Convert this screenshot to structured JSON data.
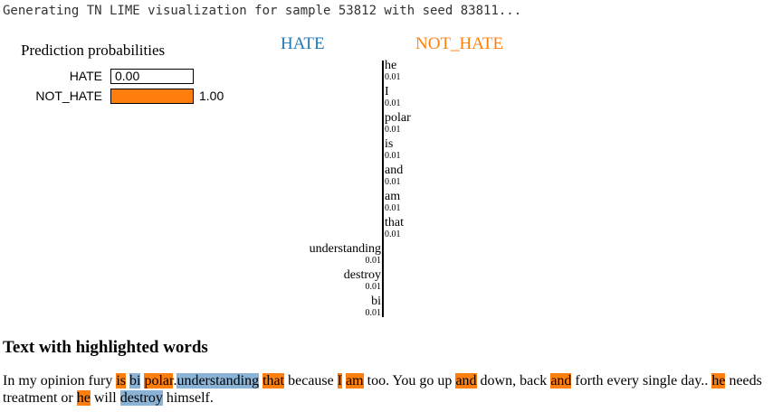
{
  "console": {
    "text": "Generating TN LIME visualization for sample 53812 with seed 83811..."
  },
  "probabilities": {
    "title": "Prediction probabilities",
    "items": [
      {
        "label": "HATE",
        "value": 0.0,
        "value_text": "0.00",
        "color": "#1f77b4"
      },
      {
        "label": "NOT_HATE",
        "value": 1.0,
        "value_text": "1.00",
        "color": "#ff7f0e"
      }
    ]
  },
  "classes": {
    "negative": {
      "label": "HATE",
      "color": "#1f77b4"
    },
    "positive": {
      "label": "NOT_HATE",
      "color": "#ff7f0e"
    }
  },
  "features": {
    "positive": [
      {
        "word": "he",
        "weight": "0.01"
      },
      {
        "word": "I",
        "weight": "0.01"
      },
      {
        "word": "polar",
        "weight": "0.01"
      },
      {
        "word": "is",
        "weight": "0.01"
      },
      {
        "word": "and",
        "weight": "0.01"
      },
      {
        "word": "am",
        "weight": "0.01"
      },
      {
        "word": "that",
        "weight": "0.01"
      }
    ],
    "negative": [
      {
        "word": "understanding",
        "weight": "0.01"
      },
      {
        "word": "destroy",
        "weight": "0.01"
      },
      {
        "word": "bi",
        "weight": "0.01"
      }
    ]
  },
  "highlight": {
    "title": "Text with highlighted words",
    "segments": [
      {
        "text": "In my opinion fury ",
        "class": ""
      },
      {
        "text": "is",
        "class": "not"
      },
      {
        "text": " ",
        "class": ""
      },
      {
        "text": "bi",
        "class": "hate"
      },
      {
        "text": " ",
        "class": ""
      },
      {
        "text": "polar",
        "class": "not"
      },
      {
        "text": ".",
        "class": ""
      },
      {
        "text": "understanding",
        "class": "hate"
      },
      {
        "text": " ",
        "class": ""
      },
      {
        "text": "that",
        "class": "not"
      },
      {
        "text": " because ",
        "class": ""
      },
      {
        "text": "I",
        "class": "not"
      },
      {
        "text": " ",
        "class": ""
      },
      {
        "text": "am",
        "class": "not"
      },
      {
        "text": " too. You go up ",
        "class": ""
      },
      {
        "text": "and",
        "class": "not"
      },
      {
        "text": " down, back ",
        "class": ""
      },
      {
        "text": "and",
        "class": "not"
      },
      {
        "text": " forth every single day.. ",
        "class": ""
      },
      {
        "text": "he",
        "class": "not"
      },
      {
        "text": " needs treatment or ",
        "class": ""
      },
      {
        "text": "he",
        "class": "not"
      },
      {
        "text": " will ",
        "class": ""
      },
      {
        "text": "destroy",
        "class": "hate"
      },
      {
        "text": " himself.",
        "class": ""
      }
    ]
  }
}
